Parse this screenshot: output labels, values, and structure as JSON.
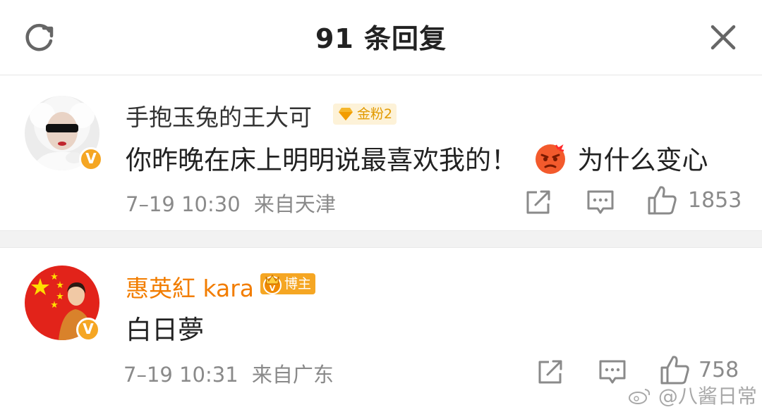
{
  "header": {
    "title": "91 条回复",
    "refresh_icon": "refresh-icon",
    "close_icon": "close-icon"
  },
  "comments": [
    {
      "username": "手抱玉兔的王大可",
      "username_color": "#333333",
      "badge": {
        "label": "金粉2",
        "color": "#f0a500",
        "bg": "#fdf2d8",
        "icon": "gold-fan-icon"
      },
      "verified": "V",
      "text_before_emoji": "你昨晚在床上明明说最喜欢我的！",
      "emoji": "angry-face-emoji",
      "text_after_emoji": "为什么变心",
      "time": "7–19 10:30",
      "location": "来自天津",
      "like_count": "1853"
    },
    {
      "username": "惠英紅 kara",
      "username_color": "#f27d00",
      "badge": {
        "label": "博主",
        "color": "#ffffff",
        "bg": "#f5a623",
        "icon": "crown-icon"
      },
      "verified": "V",
      "text": "白日夢",
      "time": "7–19 10:31",
      "location": "来自广东",
      "like_count": "758"
    }
  ],
  "watermark": "@八酱日常"
}
